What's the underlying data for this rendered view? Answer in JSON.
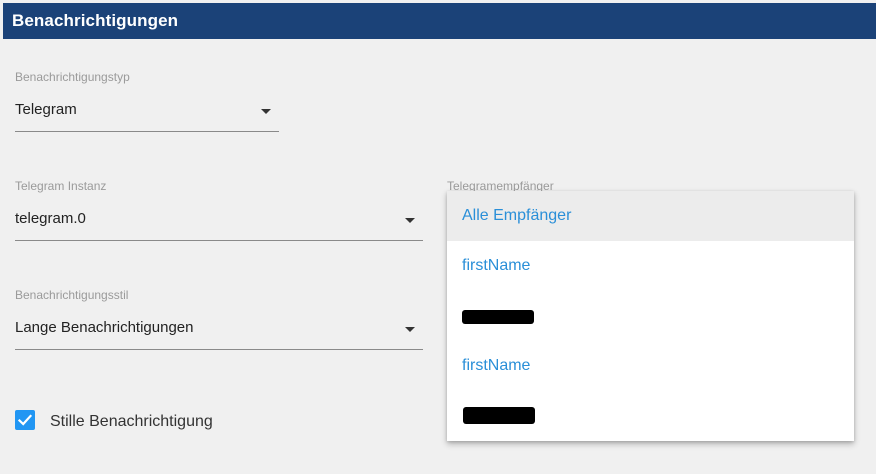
{
  "header": {
    "title": "Benachrichtigungen"
  },
  "form": {
    "type_label": "Benachrichtigungstyp",
    "type_value": "Telegram",
    "instance_label": "Telegram Instanz",
    "instance_value": "telegram.0",
    "style_label": "Benachrichtigungsstil",
    "style_value": "Lange Benachrichtigungen",
    "recipient_label": "Telegramempfänger",
    "silent_label": "Stille Benachrichtigung",
    "silent_checked": true
  },
  "recipients_dropdown": {
    "items": [
      {
        "label": "Alle Empfänger",
        "selected": true,
        "redacted": false
      },
      {
        "label": "firstName",
        "selected": false,
        "redacted": false
      },
      {
        "label": "",
        "selected": false,
        "redacted": true
      },
      {
        "label": "firstName",
        "selected": false,
        "redacted": false
      },
      {
        "label": "",
        "selected": false,
        "redacted": true
      }
    ]
  },
  "colors": {
    "header_bg": "#1b4278",
    "accent": "#2196f3",
    "link_text": "#2a8fd8",
    "background": "#f0f0f0"
  }
}
